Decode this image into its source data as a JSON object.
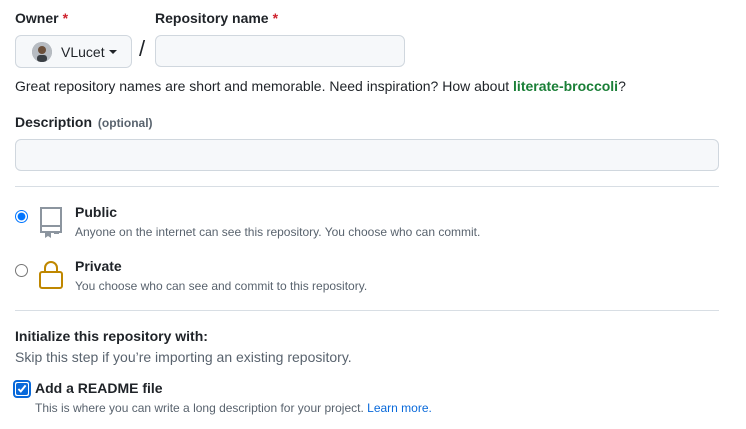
{
  "owner": {
    "label": "Owner",
    "required_mark": "*",
    "selected": "VLucet"
  },
  "repository": {
    "label": "Repository name",
    "required_mark": "*",
    "value": ""
  },
  "separator": "/",
  "inspiration": {
    "prefix": "Great repository names are short and memorable. Need inspiration? How about ",
    "suggestion": "literate-broccoli",
    "suffix": "?"
  },
  "description": {
    "label": "Description",
    "optional": "(optional)",
    "value": ""
  },
  "visibility": {
    "selected": "public",
    "options": [
      {
        "id": "public",
        "title": "Public",
        "desc": "Anyone on the internet can see this repository. You choose who can commit.",
        "icon": "repo-icon"
      },
      {
        "id": "private",
        "title": "Private",
        "desc": "You choose who can see and commit to this repository.",
        "icon": "lock-icon"
      }
    ]
  },
  "initialize": {
    "title": "Initialize this repository with:",
    "subtitle": "Skip this step if you’re importing an existing repository.",
    "readme": {
      "checked": true,
      "title": "Add a README file",
      "desc": "This is where you can write a long description for your project. ",
      "link": "Learn more."
    }
  },
  "colors": {
    "required": "#cf222e",
    "suggestion": "#1a7f37",
    "link": "#0969da"
  }
}
